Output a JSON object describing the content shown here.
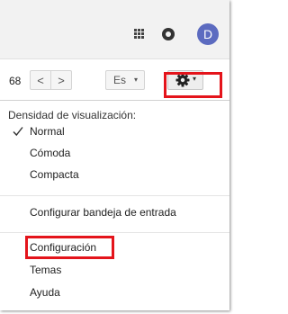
{
  "header": {
    "apps_icon": "apps-grid-icon",
    "notifications_icon": "notifications-icon",
    "avatar_initial": "D",
    "avatar_color": "#5c6bc0"
  },
  "toolbar": {
    "page_count": "68",
    "prev_label": "<",
    "next_label": ">",
    "language_label": "Es",
    "language_caret": "▾",
    "settings_icon": "gear-icon",
    "settings_caret": "▾"
  },
  "menu": {
    "heading": "Densidad de visualización:",
    "density_options": [
      {
        "label": "Normal",
        "checked": true
      },
      {
        "label": "Cómoda",
        "checked": false
      },
      {
        "label": "Compacta",
        "checked": false
      }
    ],
    "configure_inbox": "Configurar bandeja de entrada",
    "settings": "Configuración",
    "themes": "Temas",
    "help": "Ayuda"
  },
  "highlight_color": "#e4141b"
}
